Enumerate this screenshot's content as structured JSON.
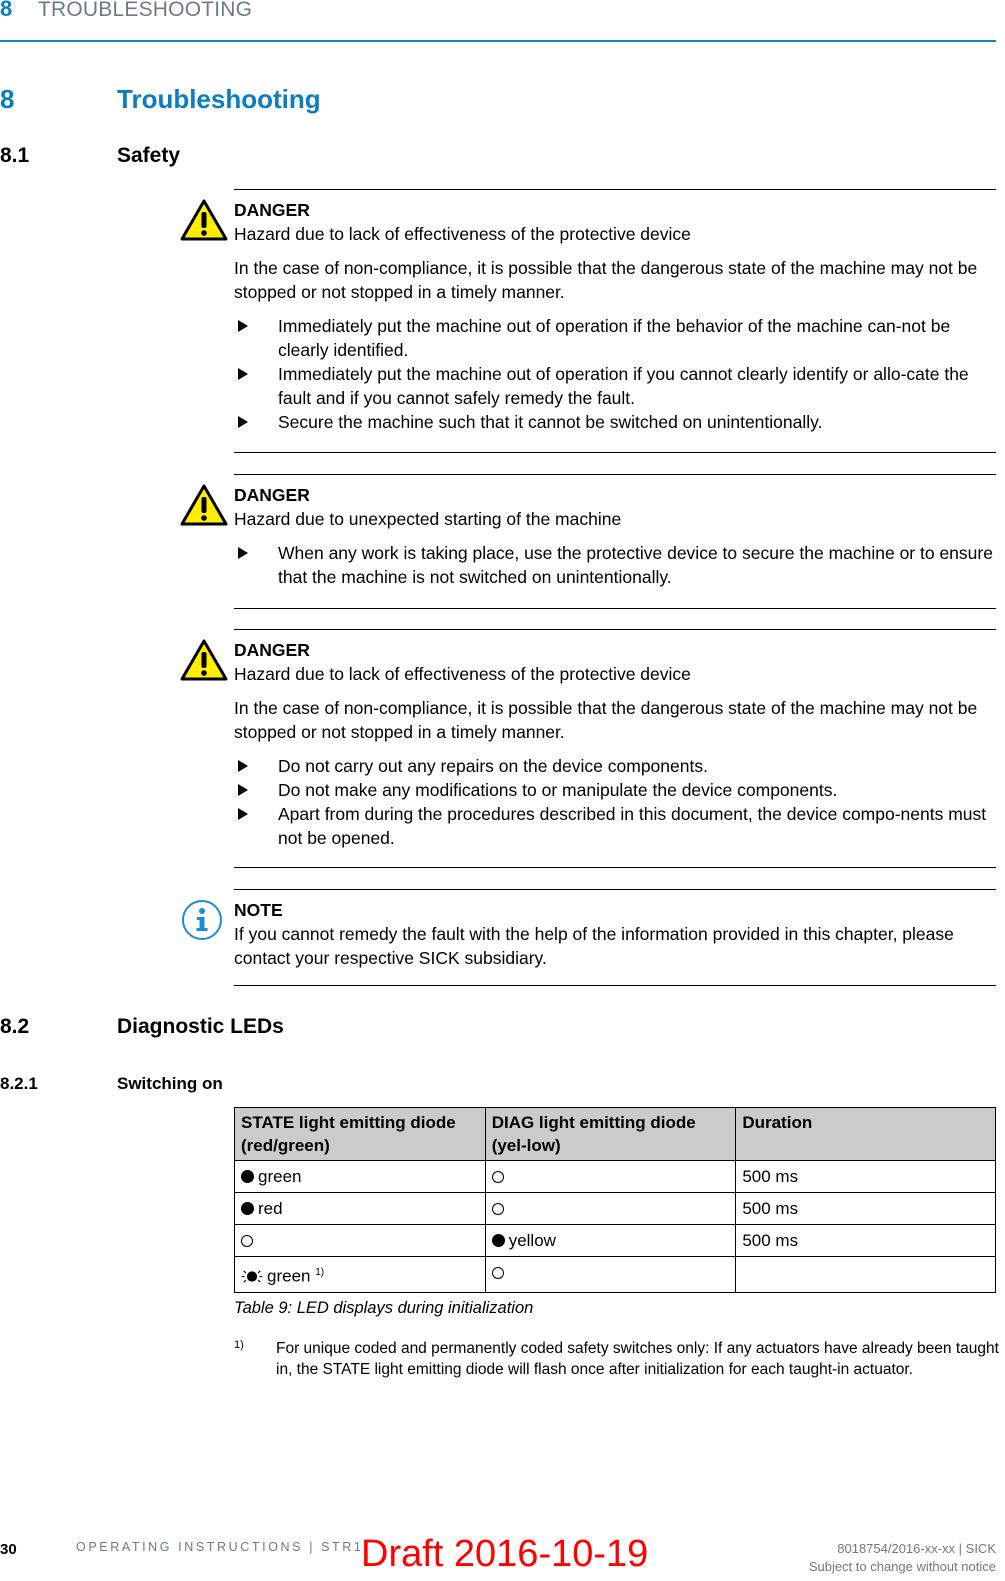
{
  "header": {
    "chapter_number": "8",
    "chapter_title": "TROUBLESHOOTING"
  },
  "heading1": {
    "number": "8",
    "title": "Troubleshooting"
  },
  "section_81": {
    "number": "8.1",
    "title": "Safety"
  },
  "notices": [
    {
      "type": "danger",
      "icon": "warning-triangle-icon",
      "label": "DANGER",
      "subtitle": "Hazard due to lack of effectiveness of the protective device",
      "paragraph": "In the case of non-compliance, it is possible that the dangerous state of the machine may not be stopped or not stopped in a timely manner.",
      "items": [
        "Immediately put the machine out of operation if the behavior of the machine can-not be clearly identified.",
        "Immediately put the machine out of operation if you cannot clearly identify or allo-cate the fault and if you cannot safely remedy the fault.",
        "Secure the machine such that it cannot be switched on unintentionally."
      ]
    },
    {
      "type": "danger",
      "icon": "warning-triangle-icon",
      "label": "DANGER",
      "subtitle": "Hazard due to unexpected starting of the machine",
      "items": [
        "When any work is taking place, use the protective device to secure the machine or to ensure that the machine is not switched on unintentionally."
      ]
    },
    {
      "type": "danger",
      "icon": "warning-triangle-icon",
      "label": "DANGER",
      "subtitle": "Hazard due to lack of effectiveness of the protective device",
      "paragraph": "In the case of non-compliance, it is possible that the dangerous state of the machine may not be stopped or not stopped in a timely manner.",
      "items": [
        "Do not carry out any repairs on the device components.",
        "Do not make any modifications to or manipulate the device components.",
        "Apart from during the procedures described in this document, the device compo-nents must not be opened."
      ]
    },
    {
      "type": "note",
      "icon": "info-icon",
      "label": "NOTE",
      "subtitle": "If you cannot remedy the fault with the help of the information provided in this chapter, please contact your respective SICK subsidiary."
    }
  ],
  "section_82": {
    "number": "8.2",
    "title": "Diagnostic LEDs"
  },
  "section_821": {
    "number": "8.2.1",
    "title": "Switching on"
  },
  "table": {
    "headers": [
      "STATE light emitting diode (red/green)",
      "DIAG light emitting diode (yel-low)",
      "Duration"
    ],
    "rows": [
      {
        "state": {
          "led": "on",
          "text": "green"
        },
        "diag": {
          "led": "off",
          "text": ""
        },
        "duration": "500 ms"
      },
      {
        "state": {
          "led": "on",
          "text": "red"
        },
        "diag": {
          "led": "off",
          "text": ""
        },
        "duration": "500 ms"
      },
      {
        "state": {
          "led": "off",
          "text": ""
        },
        "diag": {
          "led": "on",
          "text": "yellow"
        },
        "duration": "500 ms"
      },
      {
        "state": {
          "led": "flashing",
          "text": "green",
          "footnote": "1)"
        },
        "diag": {
          "led": "off",
          "text": ""
        },
        "duration": ""
      }
    ],
    "caption": "Table 9: LED displays during initialization"
  },
  "footnote": {
    "mark": "1)",
    "text": "For unique coded and permanently coded safety switches only: If any actuators have already been taught in, the STATE light emitting diode will flash once after initialization for each taught-in actuator."
  },
  "footer": {
    "page": "30",
    "doc_title": "OPERATING INSTRUCTIONS | STR1",
    "doc_number": "8018754/2016-xx-xx | SICK",
    "notice": "Subject to change without notice",
    "draft_stamp": "Draft 2016-10-19"
  },
  "colors": {
    "accent": "#0a7ec2",
    "muted": "#6e7a82",
    "warning_yellow": "#ffee00",
    "draft_red": "#ff0000",
    "table_header": "#cbcbcb"
  }
}
